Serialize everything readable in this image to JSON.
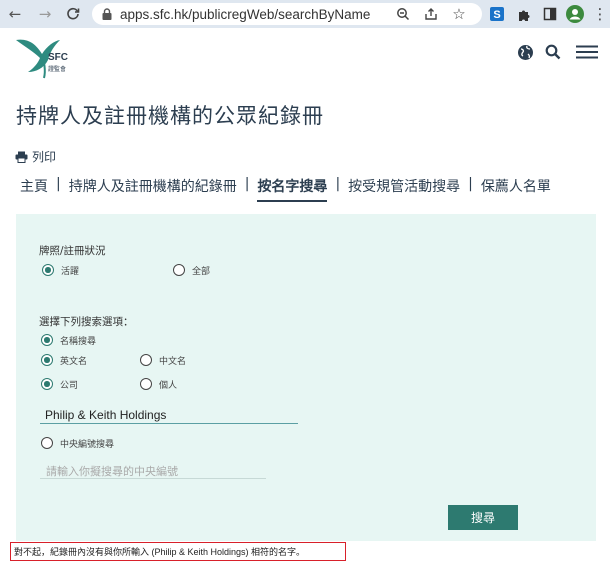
{
  "browser": {
    "url": "apps.sfc.hk/publicregWeb/searchByName?lo...",
    "back_icon": "arrow-left-icon",
    "forward_icon": "arrow-right-icon",
    "reload_icon": "reload-icon"
  },
  "site": {
    "logo_text": "SFC",
    "logo_subtext": "證監會"
  },
  "page": {
    "title": "持牌人及註冊機構的公眾紀錄冊",
    "print_label": "列印"
  },
  "tabs": [
    {
      "label": "主頁"
    },
    {
      "label": "持牌人及註冊機構的紀錄冊"
    },
    {
      "label": "按名字搜尋"
    },
    {
      "label": "按受規管活動搜尋"
    },
    {
      "label": "保薦人名單"
    }
  ],
  "form": {
    "status_label": "牌照/註冊狀況",
    "status_active": "活躍",
    "status_all": "全部",
    "search_options_label": "選擇下列搜索選項：",
    "name_search": "名稱搜尋",
    "english_name": "英文名",
    "chinese_name": "中文名",
    "company": "公司",
    "individual": "個人",
    "name_value": "Philip & Keith Holdings",
    "ce_search": "中央編號搜尋",
    "ce_placeholder": "請輸入你擬搜尋的中央編號",
    "search_button": "搜尋"
  },
  "message": "對不起，紀錄冊內沒有與你所輸入 (Philip & Keith Holdings) 相符的名字。",
  "colors": {
    "accent": "#2d7a70",
    "panel": "#e7f6f3",
    "error_border": "#d8202a"
  }
}
